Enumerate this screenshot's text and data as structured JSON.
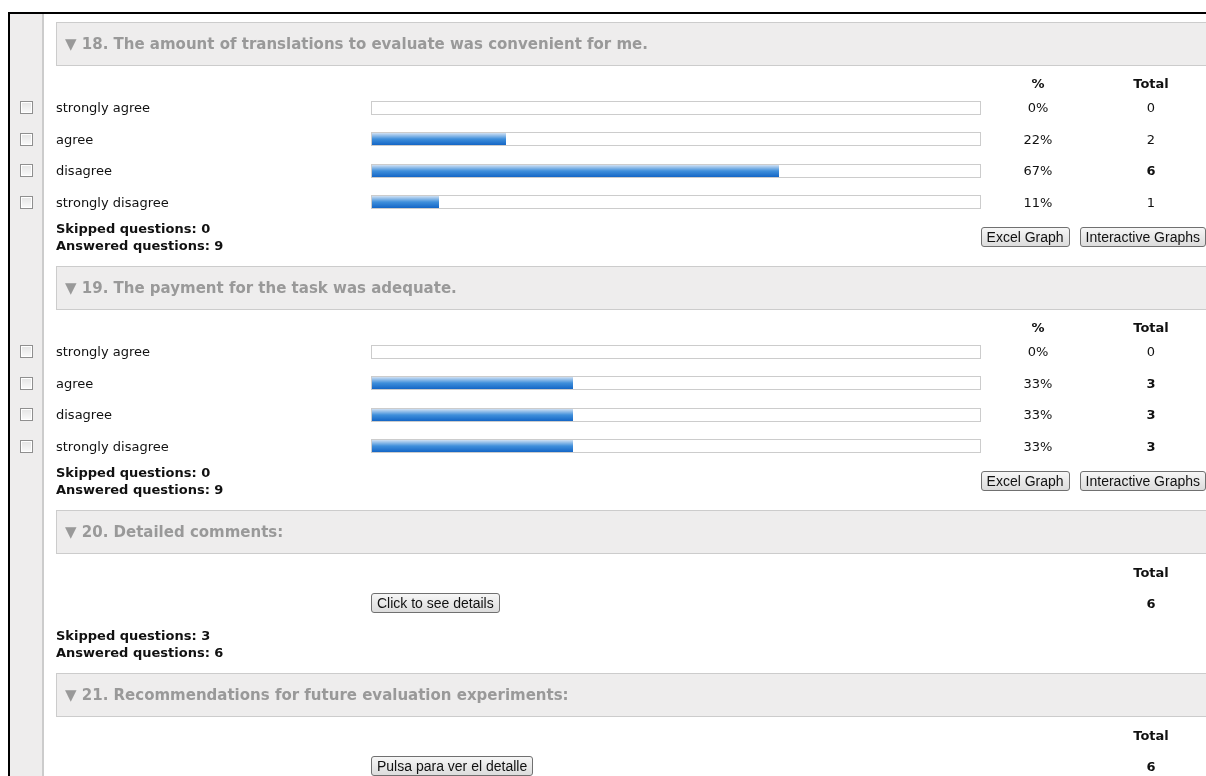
{
  "questions": [
    {
      "kind": "scale",
      "title": "▼ 18. The amount of translations to evaluate was convenient for me.",
      "percent_heading": "%",
      "total_heading": "Total",
      "rows": [
        {
          "label": "strongly agree",
          "checked": false,
          "percent": "0%",
          "total": "0",
          "bold": false
        },
        {
          "label": "agree",
          "checked": false,
          "level": 0.22,
          "percent": "22%",
          "total": "2",
          "bold": false
        },
        {
          "label": "disagree",
          "checked": false,
          "level": 0.67,
          "percent": "67%",
          "total": "6",
          "bold": true
        },
        {
          "label": "strongly disagree",
          "checked": false,
          "level": 0.11,
          "percent": "11%",
          "total": "1",
          "bold": false
        }
      ],
      "skipped": "Skipped questions: 0",
      "answered": "Answered questions: 9",
      "buttons": [
        "Excel Graph",
        "Interactive Graphs"
      ]
    },
    {
      "kind": "scale",
      "title": "▼ 19. The payment for the task was adequate.",
      "percent_heading": "%",
      "total_heading": "Total",
      "rows": [
        {
          "label": "strongly agree",
          "checked": false,
          "percent": "0%",
          "total": "0",
          "bold": false
        },
        {
          "label": "agree",
          "checked": false,
          "level": 0.33,
          "percent": "33%",
          "total": "3",
          "bold": true
        },
        {
          "label": "disagree",
          "checked": false,
          "level": 0.33,
          "percent": "33%",
          "total": "3",
          "bold": true
        },
        {
          "label": "strongly disagree",
          "checked": false,
          "level": 0.33,
          "percent": "33%",
          "total": "3",
          "bold": true
        }
      ],
      "skipped": "Skipped questions: 0",
      "answered": "Answered questions: 9",
      "buttons": [
        "Excel Graph",
        "Interactive Graphs"
      ]
    },
    {
      "kind": "text",
      "title": "▼ 20. Detailed comments:",
      "total_heading": "Total",
      "details_button": "Click to see details",
      "total": "6",
      "skipped": "Skipped questions: 3",
      "answered": "Answered questions: 6"
    },
    {
      "kind": "text",
      "title": "▼ 21. Recommendations for future evaluation experiments:",
      "total_heading": "Total",
      "details_button": "Pulsa para ver el detalle",
      "total": "6"
    }
  ]
}
